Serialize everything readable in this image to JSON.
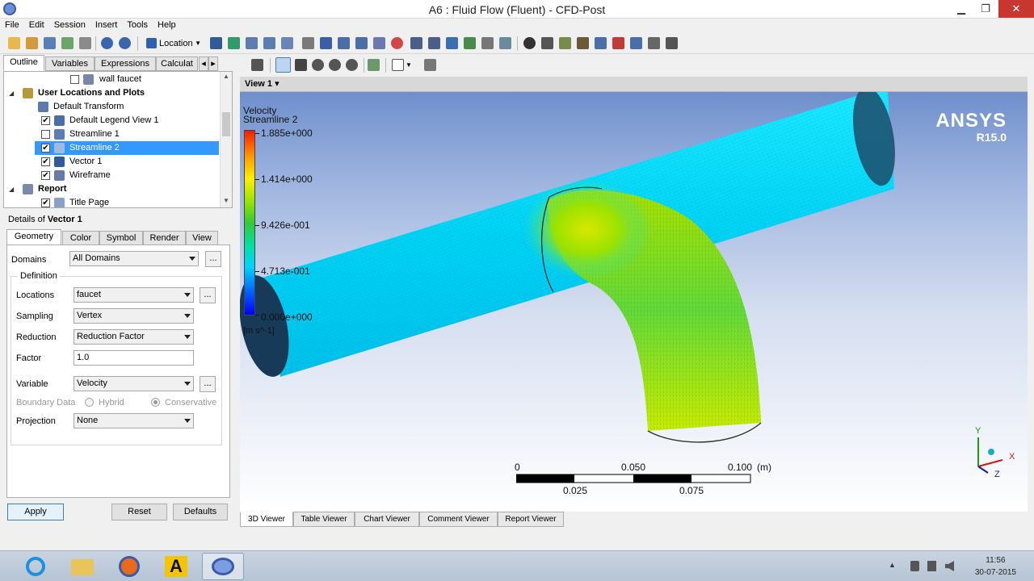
{
  "window": {
    "title": "A6 : Fluid Flow (Fluent) - CFD-Post",
    "minimize": "▁",
    "maximize": "❐",
    "close": "✕"
  },
  "menu": [
    "File",
    "Edit",
    "Session",
    "Insert",
    "Tools",
    "Help"
  ],
  "toolbar": {
    "location_label": "Location",
    "icons": [
      "load-state-icon",
      "save-state-icon",
      "save-project-icon",
      "refresh-icon",
      "camera-icon",
      "undo-icon",
      "redo-icon",
      "location-icon",
      "vector-icon",
      "contour-icon",
      "streamline-icon",
      "particle-track-icon",
      "volume-render-icon",
      "text-icon",
      "coordinate-frame-icon",
      "legend-icon",
      "instance-transform-icon",
      "clip-plane-icon",
      "color-map-icon",
      "variable-icon",
      "expression-icon",
      "table-icon",
      "chart-icon",
      "comment-icon",
      "figure-icon",
      "timestep-icon",
      "animation-icon",
      "quick-editor-icon",
      "probe-icon",
      "function-calculator-icon",
      "macro-calculator-icon",
      "mesh-calculator-icon",
      "case-comparison-icon",
      "command-editor-icon"
    ]
  },
  "left_tabs": [
    "Outline",
    "Variables",
    "Expressions",
    "Calculat"
  ],
  "tree": [
    {
      "label": "wall faucet",
      "checked": false,
      "bold": false,
      "selected": false,
      "icon": "surface-icon"
    },
    {
      "label": "User Locations and Plots",
      "checked": null,
      "bold": true,
      "selected": false,
      "icon": "folder-icon",
      "expander": "◢"
    },
    {
      "label": "Default Transform",
      "checked": null,
      "bold": false,
      "selected": false,
      "icon": "transform-icon"
    },
    {
      "label": "Default Legend View 1",
      "checked": true,
      "bold": false,
      "selected": false,
      "icon": "legend-icon"
    },
    {
      "label": "Streamline 1",
      "checked": false,
      "bold": false,
      "selected": false,
      "icon": "streamline-icon"
    },
    {
      "label": "Streamline 2",
      "checked": true,
      "bold": false,
      "selected": true,
      "icon": "streamline-icon"
    },
    {
      "label": "Vector 1",
      "checked": true,
      "bold": false,
      "selected": false,
      "icon": "vector-icon"
    },
    {
      "label": "Wireframe",
      "checked": true,
      "bold": false,
      "selected": false,
      "icon": "wireframe-icon"
    },
    {
      "label": "Report",
      "checked": null,
      "bold": true,
      "selected": false,
      "icon": "report-icon",
      "expander": "◢"
    },
    {
      "label": "Title Page",
      "checked": true,
      "bold": false,
      "selected": false,
      "icon": "page-icon"
    }
  ],
  "details": {
    "prefix": "Details of ",
    "object": "Vector 1",
    "tabs": [
      "Geometry",
      "Color",
      "Symbol",
      "Render",
      "View"
    ],
    "domains_label": "Domains",
    "domains_value": "All Domains",
    "definition_label": "Definition",
    "locations_label": "Locations",
    "locations_value": "faucet",
    "sampling_label": "Sampling",
    "sampling_value": "Vertex",
    "reduction_label": "Reduction",
    "reduction_value": "Reduction Factor",
    "factor_label": "Factor",
    "factor_value": "1.0",
    "variable_label": "Variable",
    "variable_value": "Velocity",
    "boundary_label": "Boundary Data",
    "boundary_hybrid": "Hybrid",
    "boundary_conservative": "Conservative",
    "projection_label": "Projection",
    "projection_value": "None",
    "ellipsis": "...",
    "apply": "Apply",
    "reset": "Reset",
    "defaults": "Defaults"
  },
  "viewer": {
    "view_name": "View 1 ▾",
    "legend_title_1": "Velocity",
    "legend_title_2": "Streamline 2",
    "legend_values": [
      "1.885e+000",
      "1.414e+000",
      "9.426e-001",
      "4.713e-001",
      "0.000e+000"
    ],
    "legend_unit": "[m s^-1]",
    "brand": "ANSYS",
    "version": "R15.0",
    "scale": {
      "top_labels": [
        "0",
        "0.050",
        "0.100"
      ],
      "bottom_labels": [
        "0.025",
        "0.075"
      ],
      "unit": "(m)"
    },
    "axes": {
      "x": "X",
      "y": "Y",
      "z": "Z"
    },
    "tabs": [
      "3D Viewer",
      "Table Viewer",
      "Chart Viewer",
      "Comment Viewer",
      "Report Viewer"
    ]
  },
  "taskbar": {
    "apps": [
      "internet-explorer-icon",
      "file-explorer-icon",
      "firefox-icon",
      "ansys-workbench-icon",
      "cfd-post-icon"
    ],
    "time": "11:56",
    "date": "30-07-2015",
    "tray_arrow": "▲"
  },
  "colors": {
    "accent_selection": "#3399ff",
    "pipe_slow": "#00d4ff",
    "pipe_fast": "#b8e600",
    "close_button": "#c7372f"
  }
}
